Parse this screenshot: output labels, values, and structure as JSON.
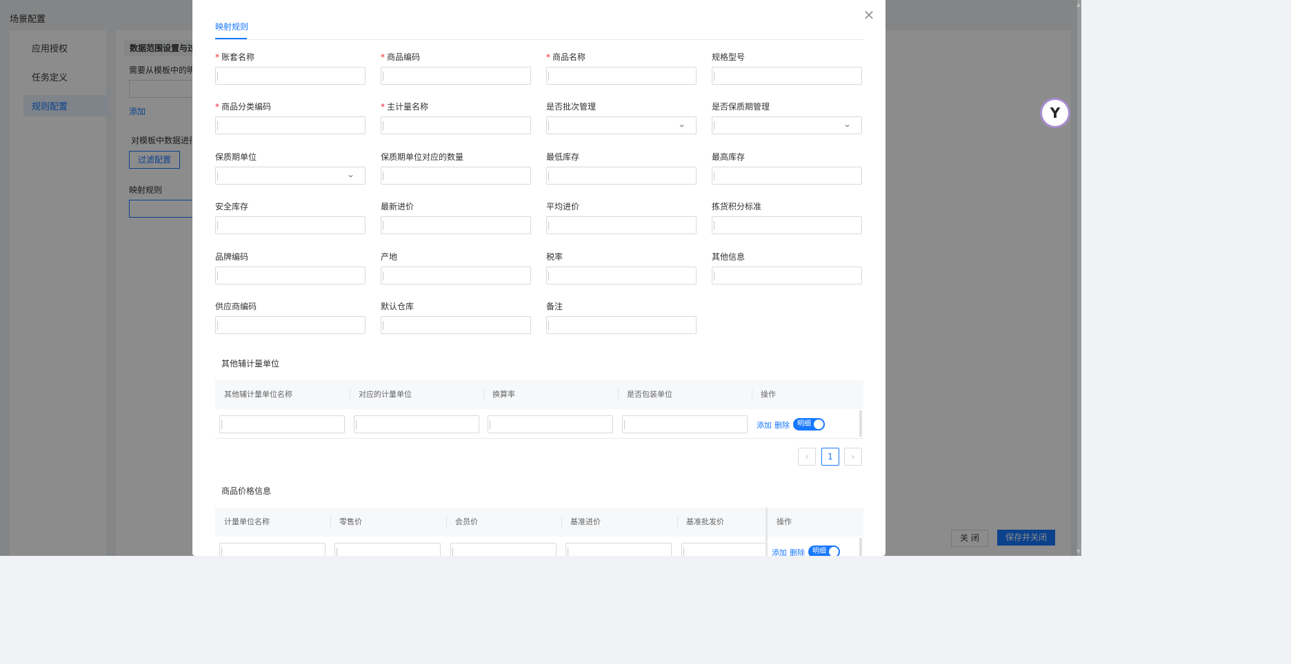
{
  "background": {
    "page_title": "场景配置",
    "sidebar": [
      "应用授权",
      "任务定义",
      "规则配置"
    ],
    "section_head": "数据范围设置与过",
    "need_text": "需要从模板中的明",
    "add_link": "添加",
    "filter_text": "对模板中数据进行",
    "filter_button": "过滤配置",
    "mapping_label": "映射规则",
    "close_button": "关 闭",
    "save_close_button": "保存并关闭"
  },
  "modal": {
    "tab": "映射规则",
    "fields": [
      {
        "label": "账套名称",
        "required": true,
        "type": "input"
      },
      {
        "label": "商品编码",
        "required": true,
        "type": "input"
      },
      {
        "label": "商品名称",
        "required": true,
        "type": "input"
      },
      {
        "label": "规格型号",
        "required": false,
        "type": "input"
      },
      {
        "label": "商品分类编码",
        "required": true,
        "type": "input"
      },
      {
        "label": "主计量名称",
        "required": true,
        "type": "input"
      },
      {
        "label": "是否批次管理",
        "required": false,
        "type": "select"
      },
      {
        "label": "是否保质期管理",
        "required": false,
        "type": "select"
      },
      {
        "label": "保质期单位",
        "required": false,
        "type": "select"
      },
      {
        "label": "保质期单位对应的数量",
        "required": false,
        "type": "input"
      },
      {
        "label": "最低库存",
        "required": false,
        "type": "input"
      },
      {
        "label": "最高库存",
        "required": false,
        "type": "input"
      },
      {
        "label": "安全库存",
        "required": false,
        "type": "input"
      },
      {
        "label": "最新进价",
        "required": false,
        "type": "input"
      },
      {
        "label": "平均进价",
        "required": false,
        "type": "input"
      },
      {
        "label": "拣货积分标准",
        "required": false,
        "type": "input"
      },
      {
        "label": "品牌编码",
        "required": false,
        "type": "input"
      },
      {
        "label": "产地",
        "required": false,
        "type": "input"
      },
      {
        "label": "税率",
        "required": false,
        "type": "input"
      },
      {
        "label": "其他信息",
        "required": false,
        "type": "input"
      },
      {
        "label": "供应商编码",
        "required": false,
        "type": "input"
      },
      {
        "label": "默认仓库",
        "required": false,
        "type": "input"
      },
      {
        "label": "备注",
        "required": false,
        "type": "input"
      }
    ],
    "aux_units": {
      "title": "其他辅计量单位",
      "columns": [
        "其他辅计量单位名称",
        "对应的计量单位",
        "换算率",
        "是否包装单位",
        "操作"
      ],
      "row_actions": {
        "add": "添加",
        "delete": "删除",
        "toggle": "明细"
      },
      "page": "1"
    },
    "price_info": {
      "title": "商品价格信息",
      "columns": [
        "计量单位名称",
        "零售价",
        "会员价",
        "基准进价",
        "基准批发价",
        "操作"
      ],
      "row_actions": {
        "add": "添加",
        "delete": "删除",
        "toggle": "明细"
      }
    }
  }
}
